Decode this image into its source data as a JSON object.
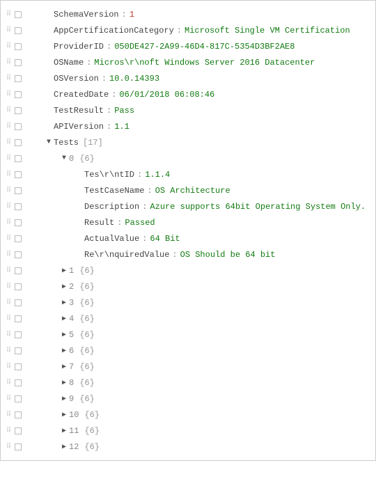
{
  "root": {
    "schemaVersion": {
      "key": "SchemaVersion",
      "value": "1"
    },
    "appCert": {
      "key": "AppCertificationCategory",
      "value": "Microsoft Single VM Certification"
    },
    "providerId": {
      "key": "ProviderID",
      "value": "050DE427-2A99-46D4-817C-5354D3BF2AE8"
    },
    "osName": {
      "key": "OSName",
      "value": "Micros\\r\\noft Windows Server 2016 Datacenter"
    },
    "osVersion": {
      "key": "OSVersion",
      "value": "10.0.14393"
    },
    "createdDate": {
      "key": "CreatedDate",
      "value": "06/01/2018 06:08:46"
    },
    "testResult": {
      "key": "TestResult",
      "value": "Pass"
    },
    "apiVersion": {
      "key": "APIVersion",
      "value": "1.1"
    },
    "tests": {
      "key": "Tests",
      "count": "[17]"
    }
  },
  "test0": {
    "index": "0",
    "size": "{6}",
    "testId": {
      "key": "Tes\\r\\ntID",
      "value": "1.1.4"
    },
    "testCaseName": {
      "key": "TestCaseName",
      "value": "OS Architecture"
    },
    "description": {
      "key": "Description",
      "value": "Azure supports 64bit Operating System Only."
    },
    "result": {
      "key": "Result",
      "value": "Passed"
    },
    "actualValue": {
      "key": "ActualValue",
      "value": "64 Bit"
    },
    "requiredValue": {
      "key": "Re\\r\\nquiredValue",
      "value": "OS Should be 64 bit"
    }
  },
  "collapsed": [
    {
      "index": "1",
      "size": "{6}"
    },
    {
      "index": "2",
      "size": "{6}"
    },
    {
      "index": "3",
      "size": "{6}"
    },
    {
      "index": "4",
      "size": "{6}"
    },
    {
      "index": "5",
      "size": "{6}"
    },
    {
      "index": "6",
      "size": "{6}"
    },
    {
      "index": "7",
      "size": "{6}"
    },
    {
      "index": "8",
      "size": "{6}"
    },
    {
      "index": "9",
      "size": "{6}"
    },
    {
      "index": "10",
      "size": "{6}"
    },
    {
      "index": "11",
      "size": "{6}"
    },
    {
      "index": "12",
      "size": "{6}"
    }
  ]
}
